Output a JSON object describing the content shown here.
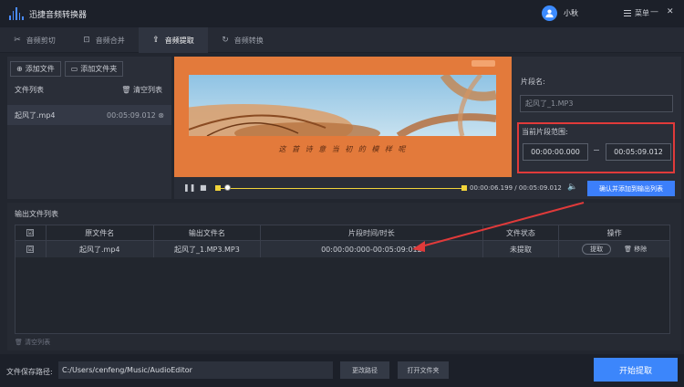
{
  "app": {
    "title": "迅捷音频转换器",
    "user": "小秋",
    "menu_label": "菜单",
    "minimize": "—",
    "close": "✕"
  },
  "tabs": [
    {
      "label": "音频剪切",
      "icon": "scissors-icon",
      "active": false
    },
    {
      "label": "音频合并",
      "icon": "merge-icon",
      "active": false
    },
    {
      "label": "音频提取",
      "icon": "extract-icon",
      "active": true
    },
    {
      "label": "音频转换",
      "icon": "convert-icon",
      "active": false
    }
  ],
  "left_panel": {
    "add_file": "添加文件",
    "add_folder": "添加文件夹",
    "file_list_label": "文件列表",
    "clear_list": "清空列表",
    "files": [
      {
        "name": "起风了.mp4",
        "duration": "00:05:09.012"
      }
    ]
  },
  "preview": {
    "subtitle": "这 首 诗 意 当 初 的 模 样 呢"
  },
  "player": {
    "current_time": "00:00:06.199",
    "separator": "/",
    "total_time": "00:05:09.012",
    "confirm_button": "确认并添加到输出列表",
    "progress": 0.02
  },
  "right_panel": {
    "segment_name_label": "片段名:",
    "segment_name_placeholder": "起风了_1.MP3",
    "range_label": "当前片段范围:",
    "start_time": "00:00:00.000",
    "end_time": "00:05:09.012"
  },
  "output": {
    "title": "输出文件列表",
    "columns": [
      "原文件名",
      "输出文件名",
      "片段时间/时长",
      "文件状态",
      "操作"
    ],
    "rows": [
      {
        "source": "起风了.mp4",
        "output": "起风了_1.MP3.MP3",
        "range": "00:00:00:000-00:05:09:012",
        "status": "未提取",
        "extract": "提取",
        "remove": "移除"
      }
    ],
    "clear_list": "清空列表"
  },
  "bottom": {
    "save_path_label": "文件保存路径:",
    "save_path": "C:/Users/cenfeng/Music/AudioEditor",
    "change_path": "更改路径",
    "open_folder": "打开文件夹",
    "start_button": "开始提取"
  },
  "colors": {
    "accent": "#3c86fb",
    "highlight": "#e03a3a",
    "track": "#f1d43a"
  }
}
